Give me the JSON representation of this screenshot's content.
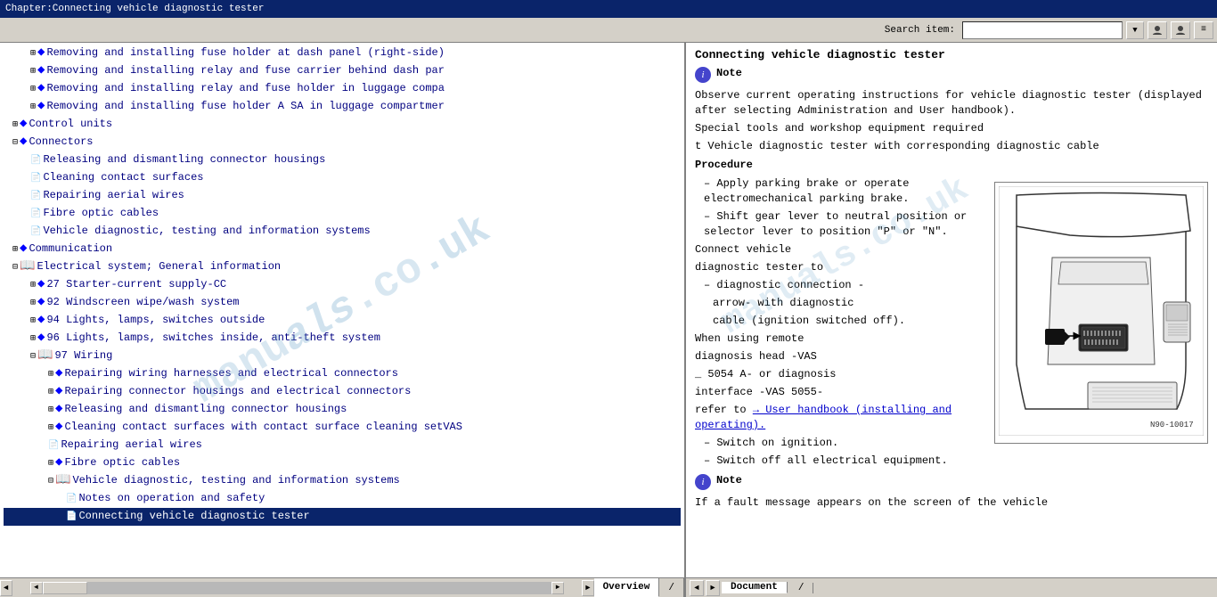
{
  "titleBar": {
    "text": "Chapter:Connecting vehicle diagnostic tester"
  },
  "toolbar": {
    "searchLabel": "Search item:",
    "searchPlaceholder": "",
    "dropdownArrow": "▼",
    "btn1": "👤",
    "btn2": "👤",
    "btn3": "≡"
  },
  "leftPanel": {
    "items": [
      {
        "level": 1,
        "type": "plus-diamond",
        "text": "Removing and installing fuse holder at dash panel (right-side)"
      },
      {
        "level": 1,
        "type": "plus-diamond",
        "text": "Removing and installing relay and fuse carrier behind dash par"
      },
      {
        "level": 1,
        "type": "plus-diamond",
        "text": "Removing and installing relay and fuse holder in luggage compa"
      },
      {
        "level": 1,
        "type": "plus-diamond",
        "text": "Removing and installing fuse holder A SA in luggage compartmer"
      },
      {
        "level": 0,
        "type": "plus-diamond",
        "text": "Control units"
      },
      {
        "level": 0,
        "type": "plus-diamond",
        "text": "Connectors"
      },
      {
        "level": 1,
        "type": "doc",
        "text": "Releasing and dismantling connector housings"
      },
      {
        "level": 1,
        "type": "doc",
        "text": "Cleaning contact surfaces"
      },
      {
        "level": 1,
        "type": "doc",
        "text": "Repairing aerial wires"
      },
      {
        "level": 1,
        "type": "doc",
        "text": "Fibre optic cables"
      },
      {
        "level": 1,
        "type": "doc",
        "text": "Vehicle diagnostic, testing and information systems"
      },
      {
        "level": 0,
        "type": "plus-diamond",
        "text": "Communication"
      },
      {
        "level": 0,
        "type": "open-diamond",
        "text": "Electrical system; General information"
      },
      {
        "level": 1,
        "type": "plus-diamond",
        "text": "27 Starter-current supply-CC"
      },
      {
        "level": 1,
        "type": "plus-diamond",
        "text": "92 Windscreen wipe/wash system"
      },
      {
        "level": 1,
        "type": "plus-diamond",
        "text": "94 Lights, lamps, switches outside"
      },
      {
        "level": 1,
        "type": "plus-diamond",
        "text": "96 Lights, lamps, switches inside, anti-theft system"
      },
      {
        "level": 1,
        "type": "open-diamond",
        "text": "97 Wiring"
      },
      {
        "level": 2,
        "type": "plus-diamond",
        "text": "Repairing wiring harnesses and electrical connectors"
      },
      {
        "level": 2,
        "type": "plus-diamond",
        "text": "Repairing connector housings and electrical connectors"
      },
      {
        "level": 2,
        "type": "plus-diamond",
        "text": "Releasing and dismantling connector housings"
      },
      {
        "level": 2,
        "type": "plus-diamond",
        "text": "Cleaning contact surfaces with contact surface cleaning setVAS"
      },
      {
        "level": 2,
        "type": "doc",
        "text": "Repairing aerial wires"
      },
      {
        "level": 2,
        "type": "plus-diamond",
        "text": "Fibre optic cables"
      },
      {
        "level": 2,
        "type": "open-diamond",
        "text": "Vehicle diagnostic, testing and information systems"
      },
      {
        "level": 3,
        "type": "doc",
        "text": "Notes on operation and safety"
      },
      {
        "level": 3,
        "type": "doc",
        "text": "Connecting vehicle diagnostic tester"
      }
    ]
  },
  "rightPanel": {
    "title": "Connecting vehicle diagnostic tester",
    "noteLabel": "Note",
    "noteIcon": "i",
    "noteText": "Observe current operating instructions for vehicle diagnostic tester (displayed after selecting Administration and User handbook).",
    "specialToolsLabel": "Special tools and workshop equipment required",
    "toolItem": "t  Vehicle diagnostic tester with corresponding diagnostic cable",
    "procedureLabel": "Procedure",
    "steps": [
      "– Apply parking brake or operate electromechanical parking brake.",
      "– Shift gear lever to neutral position or selector lever to position \"P\" or \"N\".",
      "Connect vehicle diagnostic tester to – diagnostic connection - arrow- with diagnostic cable (ignition switched off).",
      "When using remote diagnosis head -VAS _ 5054 A- or diagnosis interface -VAS 5055- refer to",
      "– Switch on ignition.",
      "– Switch off all electrical equipment."
    ],
    "linkText": "→ User handbook (installing and operating).",
    "note2Label": "Note",
    "note2Text": "If a fault message appears on the screen of the vehicle",
    "diagramLabel": "N90-10017",
    "arrowText": "arrow - With diagnostic"
  },
  "statusBar": {
    "leftTabs": [
      {
        "label": "Overview",
        "active": false
      },
      {
        "label": "/",
        "active": false
      }
    ],
    "rightTabs": [
      {
        "label": "Document",
        "active": false
      },
      {
        "label": "/",
        "active": false
      }
    ],
    "navLeft": "◄",
    "navRight": "►"
  }
}
